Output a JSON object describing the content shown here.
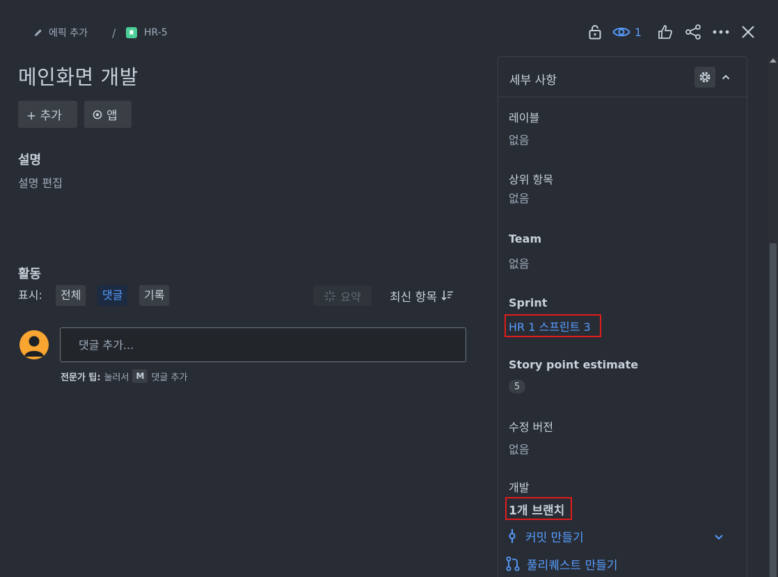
{
  "breadcrumb": {
    "epic_label": "에픽 추가",
    "separator": "/",
    "issue_key": "HR-5"
  },
  "top_actions": {
    "watch_count": "1"
  },
  "issue": {
    "title": "메인화면 개발",
    "add_button": "+ 추가",
    "app_button": "앱"
  },
  "description": {
    "heading": "설명",
    "edit_placeholder": "설명 편집"
  },
  "activity": {
    "heading": "활동",
    "show_label": "표시:",
    "filters": [
      "전체",
      "댓글",
      "기록"
    ],
    "active_filter": "댓글",
    "summary_button": "요약",
    "sort_button": "최신 항목",
    "comment_placeholder": "댓글 추가...",
    "tip_strong": "전문가 팁:",
    "tip_prefix": "눌러서",
    "tip_key": "M",
    "tip_suffix": "댓글 추가"
  },
  "details": {
    "title": "세부 사항",
    "labels": {
      "label": "레이블",
      "value": "없음"
    },
    "parent": {
      "label": "상위 항목",
      "value": "없음"
    },
    "team": {
      "label": "Team",
      "value": "없음"
    },
    "sprint": {
      "label": "Sprint",
      "value": "HR 1 스프린트 3"
    },
    "story_points": {
      "label": "Story point estimate",
      "value": "5"
    },
    "fix_version": {
      "label": "수정 버전",
      "value": "없음"
    },
    "development": {
      "label": "개발",
      "branch": "1개 브랜치",
      "create_commit": "커밋 만들기",
      "create_pr": "풀리퀘스트 만들기"
    }
  },
  "colors": {
    "background": "#282c34",
    "link": "#579dff",
    "highlight_box": "#e21c1c",
    "story_badge": "#4bce97",
    "avatar": "#f8a531"
  }
}
